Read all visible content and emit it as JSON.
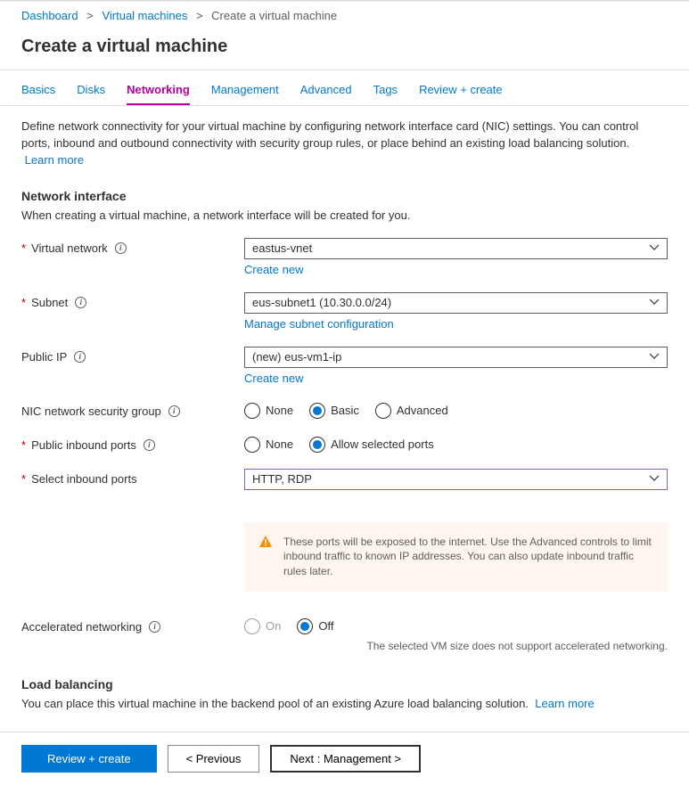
{
  "breadcrumb": {
    "items": [
      "Dashboard",
      "Virtual machines",
      "Create a virtual machine"
    ]
  },
  "page_title": "Create a virtual machine",
  "tabs": [
    {
      "label": "Basics",
      "active": false
    },
    {
      "label": "Disks",
      "active": false
    },
    {
      "label": "Networking",
      "active": true
    },
    {
      "label": "Management",
      "active": false
    },
    {
      "label": "Advanced",
      "active": false
    },
    {
      "label": "Tags",
      "active": false
    },
    {
      "label": "Review + create",
      "active": false
    }
  ],
  "description": "Define network connectivity for your virtual machine by configuring network interface card (NIC) settings. You can control ports, inbound and outbound connectivity with security group rules, or place behind an existing load balancing solution.",
  "learn_more": "Learn more",
  "sections": {
    "network_interface": {
      "heading": "Network interface",
      "subtext": "When creating a virtual machine, a network interface will be created for you."
    },
    "load_balancing": {
      "heading": "Load balancing",
      "subtext": "You can place this virtual machine in the backend pool of an existing Azure load balancing solution.",
      "learn_more": "Learn more"
    }
  },
  "fields": {
    "virtual_network": {
      "label": "Virtual network",
      "required": true,
      "value": "eastus-vnet",
      "create_new": "Create new"
    },
    "subnet": {
      "label": "Subnet",
      "required": true,
      "value": "eus-subnet1 (10.30.0.0/24)",
      "manage_link": "Manage subnet configuration"
    },
    "public_ip": {
      "label": "Public IP",
      "required": false,
      "value": "(new) eus-vm1-ip",
      "create_new": "Create new"
    },
    "nic_nsg": {
      "label": "NIC network security group",
      "options": [
        "None",
        "Basic",
        "Advanced"
      ],
      "selected": "Basic"
    },
    "public_inbound_ports": {
      "label": "Public inbound ports",
      "required": true,
      "options": [
        "None",
        "Allow selected ports"
      ],
      "selected": "Allow selected ports"
    },
    "select_inbound_ports": {
      "label": "Select inbound ports",
      "required": true,
      "value": "HTTP, RDP"
    },
    "accelerated_networking": {
      "label": "Accelerated networking",
      "options": [
        "On",
        "Off"
      ],
      "selected": "Off",
      "note": "The selected VM size does not support accelerated networking."
    }
  },
  "warning": "These ports will be exposed to the internet. Use the Advanced controls to limit inbound traffic to known IP addresses. You can also update inbound traffic rules later.",
  "footer": {
    "review": "Review + create",
    "previous": "< Previous",
    "next": "Next : Management >"
  }
}
